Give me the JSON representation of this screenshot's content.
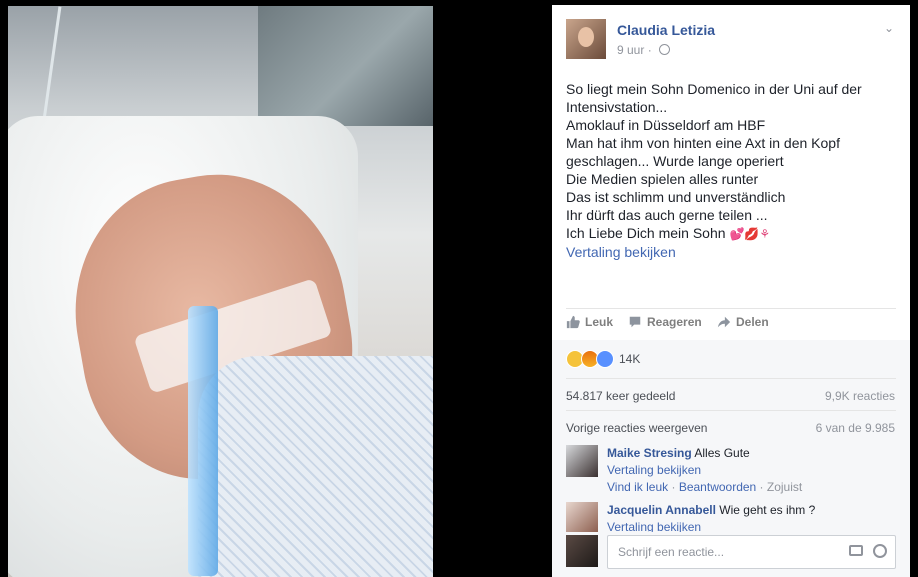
{
  "post": {
    "author": "Claudia Letizia",
    "time": "9 uur",
    "lines": [
      "So liegt mein Sohn Domenico in der Uni auf der",
      "Intensivstation...",
      "Amoklauf in Düsseldorf am HBF",
      "Man hat ihm von hinten eine Axt in den Kopf",
      "geschlagen... Wurde lange operiert",
      "Die Medien spielen alles runter",
      "Das ist schlimm und unverständlich",
      "Ihr dürft das auch gerne teilen ...",
      "Ich Liebe Dich mein Sohn"
    ],
    "emoji_text": "💕💋⚘",
    "translate_label": "Vertaling bekijken"
  },
  "actions": {
    "like": "Leuk",
    "react": "Reageren",
    "share": "Delen"
  },
  "stats": {
    "reaction_count": "14K",
    "shares": "54.817 keer gedeeld",
    "reactions": "9,9K reacties",
    "previous": "Vorige reacties weergeven",
    "count_of": "6 van de 9.985"
  },
  "comments": [
    {
      "name": "Maike Stresing",
      "text": "Alles Gute",
      "translate": "Vertaling bekijken",
      "like_link": "Vind ik leuk",
      "reply_link": "Beantwoorden",
      "time": "Zojuist"
    },
    {
      "name": "Jacquelin Annabell",
      "text": "Wie geht es ihm ?",
      "translate": "Vertaling bekijken"
    }
  ],
  "reply": {
    "placeholder": "Schrijf een reactie..."
  },
  "colors": {
    "link": "#365899",
    "accent": "#4267b2",
    "muted": "#90949c"
  }
}
